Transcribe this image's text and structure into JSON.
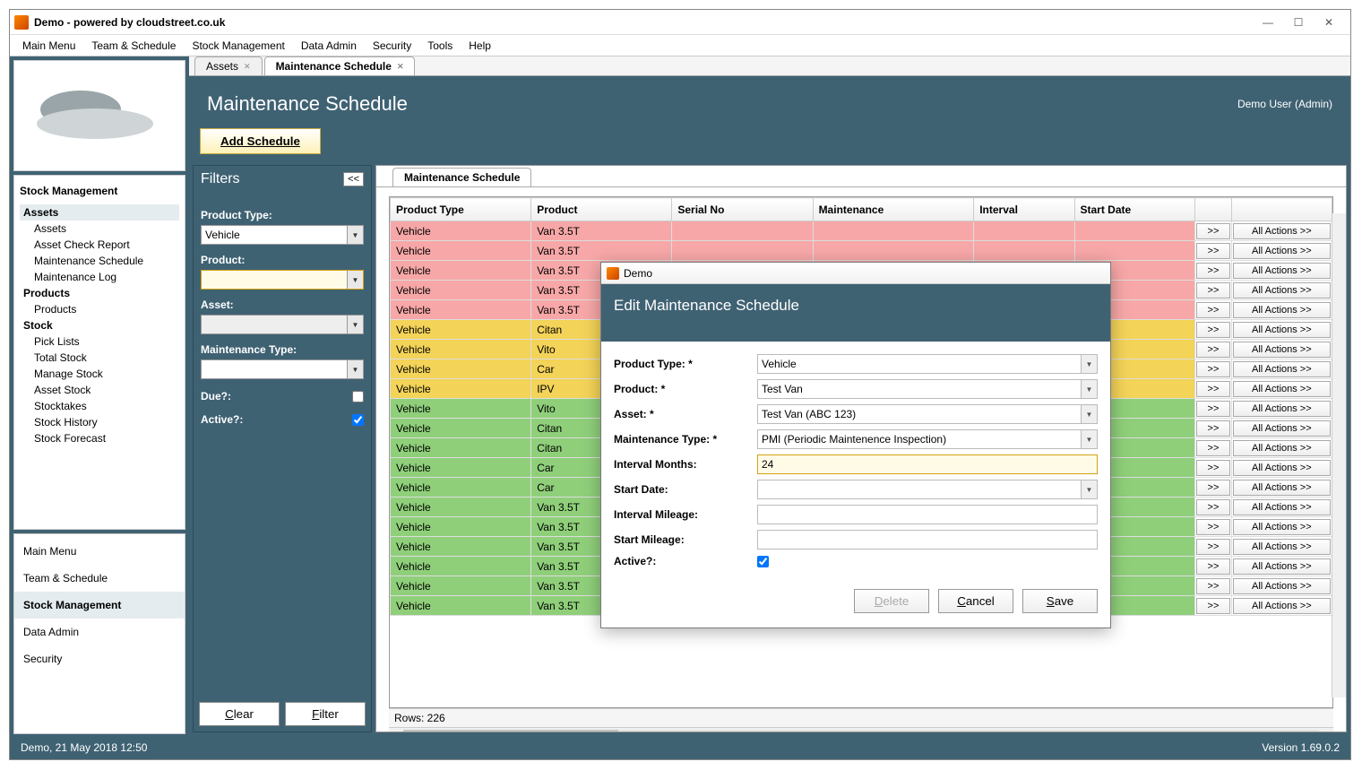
{
  "window": {
    "title": "Demo - powered by cloudstreet.co.uk"
  },
  "menubar": [
    "Main Menu",
    "Team & Schedule",
    "Stock Management",
    "Data Admin",
    "Security",
    "Tools",
    "Help"
  ],
  "sidebar": {
    "title": "Stock Management",
    "tree": [
      {
        "label": "Assets",
        "header": true,
        "selected": true
      },
      {
        "label": "Assets"
      },
      {
        "label": "Asset Check Report"
      },
      {
        "label": "Maintenance Schedule"
      },
      {
        "label": "Maintenance Log"
      },
      {
        "label": "Products",
        "header": true
      },
      {
        "label": "Products"
      },
      {
        "label": "Stock",
        "header": true
      },
      {
        "label": "Pick Lists"
      },
      {
        "label": "Total Stock"
      },
      {
        "label": "Manage Stock"
      },
      {
        "label": "Asset Stock"
      },
      {
        "label": "Stocktakes"
      },
      {
        "label": "Stock History"
      },
      {
        "label": "Stock Forecast"
      }
    ],
    "nav": [
      {
        "label": "Main Menu"
      },
      {
        "label": "Team & Schedule"
      },
      {
        "label": "Stock Management",
        "active": true
      },
      {
        "label": "Data Admin"
      },
      {
        "label": "Security"
      }
    ]
  },
  "tabs": [
    {
      "label": "Assets",
      "active": false
    },
    {
      "label": "Maintenance Schedule",
      "active": true
    }
  ],
  "doc": {
    "title": "Maintenance Schedule",
    "user": "Demo User (Admin)",
    "addBtn": "Add Schedule"
  },
  "filters": {
    "title": "Filters",
    "collapse": "<<",
    "productTypeLabel": "Product Type:",
    "productTypeValue": "Vehicle",
    "productLabel": "Product:",
    "productValue": "",
    "assetLabel": "Asset:",
    "assetValue": "",
    "maintTypeLabel": "Maintenance Type:",
    "maintTypeValue": "",
    "dueLabel": "Due?:",
    "activeLabel": "Active?:",
    "clear": "Clear",
    "filter": "Filter"
  },
  "grid": {
    "tabLabel": "Maintenance Schedule",
    "headers": [
      "Product Type",
      "Product",
      "Serial No",
      "Maintenance",
      "Interval",
      "Start Date",
      "",
      ""
    ],
    "moreBtn": ">>",
    "actionsBtn": "All Actions >>",
    "rowsLabel": "Rows: 226",
    "rows": [
      {
        "c": "red",
        "pt": "Vehicle",
        "p": "Van 3.5T"
      },
      {
        "c": "red",
        "pt": "Vehicle",
        "p": "Van 3.5T"
      },
      {
        "c": "red",
        "pt": "Vehicle",
        "p": "Van 3.5T"
      },
      {
        "c": "red",
        "pt": "Vehicle",
        "p": "Van 3.5T"
      },
      {
        "c": "red",
        "pt": "Vehicle",
        "p": "Van 3.5T"
      },
      {
        "c": "gold",
        "pt": "Vehicle",
        "p": "Citan"
      },
      {
        "c": "gold",
        "pt": "Vehicle",
        "p": "Vito"
      },
      {
        "c": "gold",
        "pt": "Vehicle",
        "p": "Car"
      },
      {
        "c": "gold",
        "pt": "Vehicle",
        "p": "IPV"
      },
      {
        "c": "green",
        "pt": "Vehicle",
        "p": "Vito"
      },
      {
        "c": "green",
        "pt": "Vehicle",
        "p": "Citan"
      },
      {
        "c": "green",
        "pt": "Vehicle",
        "p": "Citan"
      },
      {
        "c": "green",
        "pt": "Vehicle",
        "p": "Car"
      },
      {
        "c": "green",
        "pt": "Vehicle",
        "p": "Car"
      },
      {
        "c": "green",
        "pt": "Vehicle",
        "p": "Van 3.5T"
      },
      {
        "c": "green",
        "pt": "Vehicle",
        "p": "Van 3.5T"
      },
      {
        "c": "green",
        "pt": "Vehicle",
        "p": "Van 3.5T"
      },
      {
        "c": "green",
        "pt": "Vehicle",
        "p": "Van 3.5T"
      },
      {
        "c": "green",
        "pt": "Vehicle",
        "p": "Van 3.5T"
      },
      {
        "c": "green",
        "pt": "Vehicle",
        "p": "Van 3.5T"
      }
    ]
  },
  "dialog": {
    "title": "Demo",
    "header": "Edit Maintenance Schedule",
    "fields": {
      "productTypeLabel": "Product Type: *",
      "productTypeValue": "Vehicle",
      "productLabel": "Product: *",
      "productValue": "Test Van",
      "assetLabel": "Asset: *",
      "assetValue": "Test Van (ABC 123)",
      "maintTypeLabel": "Maintenance Type: *",
      "maintTypeValue": "PMI (Periodic Maintenence Inspection)",
      "intervalMonthsLabel": "Interval Months:",
      "intervalMonthsValue": "24",
      "startDateLabel": "Start Date:",
      "startDateValue": "",
      "intervalMileageLabel": "Interval Mileage:",
      "intervalMileageValue": "",
      "startMileageLabel": "Start Mileage:",
      "startMileageValue": "",
      "activeLabel": "Active?:"
    },
    "buttons": {
      "delete": "Delete",
      "cancel": "Cancel",
      "save": "Save"
    }
  },
  "statusbar": {
    "left": "Demo, 21 May 2018 12:50",
    "right": "Version 1.69.0.2"
  }
}
